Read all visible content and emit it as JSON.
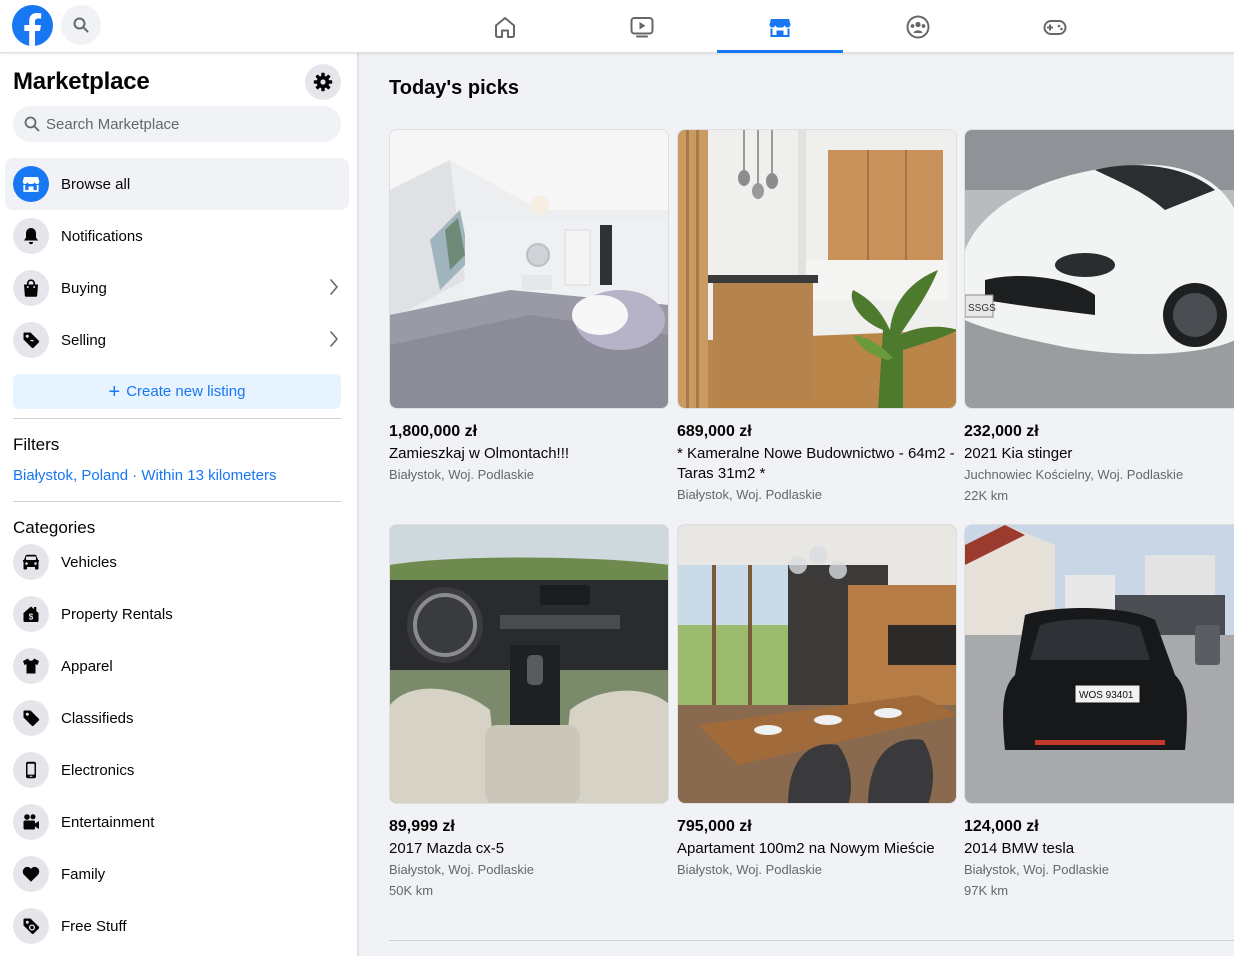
{
  "colors": {
    "accent": "#1877f2",
    "icon": "#050505",
    "muted": "#65676b",
    "panel": "#f0f2f5"
  },
  "topbar": {
    "logo_icon": "facebook-logo-icon",
    "search_icon": "search-icon",
    "tabs": [
      {
        "name": "home-icon"
      },
      {
        "name": "watch-icon"
      },
      {
        "name": "marketplace-icon",
        "active": true
      },
      {
        "name": "groups-icon"
      },
      {
        "name": "gaming-icon"
      }
    ]
  },
  "sidebar": {
    "title": "Marketplace",
    "settings_icon": "gear-icon",
    "search_placeholder": "Search Marketplace",
    "menu": [
      {
        "label": "Browse all",
        "icon": "storefront-icon",
        "active": true
      },
      {
        "label": "Notifications",
        "icon": "bell-icon"
      },
      {
        "label": "Buying",
        "icon": "shopping-bag-icon",
        "chevron": true
      },
      {
        "label": "Selling",
        "icon": "price-tag-icon",
        "chevron": true
      }
    ],
    "create_listing": "Create new listing",
    "filters_heading": "Filters",
    "location": "Białystok, Poland · Within 13 kilometers",
    "categories_heading": "Categories",
    "categories": [
      {
        "label": "Vehicles",
        "icon": "car-icon"
      },
      {
        "label": "Property Rentals",
        "icon": "house-dollar-icon"
      },
      {
        "label": "Apparel",
        "icon": "shirt-icon"
      },
      {
        "label": "Classifieds",
        "icon": "price-tag-icon"
      },
      {
        "label": "Electronics",
        "icon": "phone-icon"
      },
      {
        "label": "Entertainment",
        "icon": "video-camera-icon"
      },
      {
        "label": "Family",
        "icon": "heart-icon"
      },
      {
        "label": "Free Stuff",
        "icon": "free-tag-icon"
      }
    ]
  },
  "main": {
    "title": "Today's picks",
    "listings": [
      {
        "price": "1,800,000 zł",
        "title": "Zamieszkaj w Olmontach!!!",
        "location": "Białystok, Woj. Podlaskie",
        "extra": "",
        "image": "bedroom-photo"
      },
      {
        "price": "689,000 zł",
        "title": "* Kameralne Nowe Budownictwo - 64m2 - Taras 31m2 *",
        "location": "Białystok, Woj. Podlaskie",
        "extra": "",
        "image": "kitchen-photo"
      },
      {
        "price": "232,000 zł",
        "title": "2021 Kia stinger",
        "location": "Juchnowiec Kościelny, Woj. Podlaskie",
        "extra": "22K km",
        "image": "white-car-photo"
      },
      {
        "price": "89,999 zł",
        "title": "2017 Mazda cx-5",
        "location": "Białystok, Woj. Podlaskie",
        "extra": "50K km",
        "image": "car-interior-photo"
      },
      {
        "price": "795,000 zł",
        "title": "Apartament 100m2 na Nowym Mieście",
        "location": "Białystok, Woj. Podlaskie",
        "extra": "",
        "image": "dining-room-photo"
      },
      {
        "price": "124,000 zł",
        "title": "2014 BMW tesla",
        "location": "Białystok, Woj. Podlaskie",
        "extra": "97K km",
        "image": "black-car-photo"
      }
    ]
  }
}
